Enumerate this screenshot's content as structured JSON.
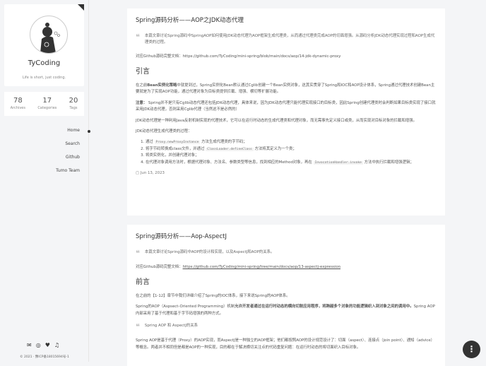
{
  "profile": {
    "name": "TyCoding",
    "motto": "Life is short, just coding."
  },
  "stats": [
    {
      "n": "78",
      "l": "Archives"
    },
    {
      "n": "17",
      "l": "Categories"
    },
    {
      "n": "20",
      "l": "Tags"
    }
  ],
  "nav": [
    "Home",
    "Search",
    "Github",
    "Tumo Team"
  ],
  "footer": {
    "copyright": "© 2021 · 豫ICP备18015694号-1"
  },
  "posts": [
    {
      "title": "Spring源码分析——AOP之JDK动态代理",
      "quote": "本篇文章讨论Spring源码中SpringAOP如何使用JDK动态代理为AOP框架生成代理类，从而通过代理类完成AOP的切面增强。从源码分析JDK动态代理实现过程和AOP生成代理类的过程。",
      "doc_label": "对应Github源码完整文档：",
      "doc_link": "https://github.com/TyCoding/mini-spring/blob/main/docs/aop/14-jdk-dynamic-proxy",
      "heading": "引言",
      "p1_a": "在之前",
      "p1_b": "Bean实例化策略",
      "p1_c": "中就提到过，Spring实例化Bean默认通过Cglib创建一个Bean实例对象，这其实贯穿了Spring和IOC和AOP设计体系，Spring通过代理技术创建Bean主要就是为了实现AOP功能，通过代理对象为目标类提供拦截、增强、横切等扩展功能。",
      "p2_a": "注意：",
      "p2_b": "Spring并不是只有Cglib动态代理还包括JDK动态代理，具体来说，因为JDK动态代理只能代理实现接口的目标类，因此Spring创建代理类时会判断如果目标类实现了接口就采用JDK动态代理，否则采用Cglib代理（当然这不是必然的）",
      "p3": "JDK动态代理是一种利用Java反射机制实现的代理技术，它可以在运行时动态的生成代理类和代理对象，而无需事先定义接口或类，从而实现对目标对象的拦截和增强。",
      "p4": "JDK动态代理生成代理类的过程：",
      "steps": [
        {
          "a": "通过 ",
          "code": "Proxy.newProxyInstance",
          "b": " 方法生成代理类的字节码；"
        },
        {
          "a": "将字节码转换成class文件，并通过 ",
          "code": "ClassLoader.defineClass",
          "b": " 方法将其定义为一个类；"
        },
        {
          "a": "将类实例化，并创建代理对象；",
          "code": "",
          "b": ""
        },
        {
          "a": "在代理对象调用方法时，根据代理对象、方法名、参数类型等信息，找到相应的Method对象，再在 ",
          "code": "InvocationHandler.invoke",
          "b": " 方法中执行拦截和增强逻辑；"
        }
      ],
      "date": "Jun 13, 2023"
    },
    {
      "title": "Spring源码分析——Aop-AspectJ",
      "quote": "本篇文章讨论Spring源码中AOP的设计和实现，以及AspectJ和AOP的关系。",
      "doc_label": "对应Github源码完整文档：",
      "doc_link": "https://github.com/TyCoding/mini-spring/tree/main/docs/aop/13-aspectj-expression",
      "heading": "前言",
      "p1": "在之前的【1-12】章节中我们详细介绍了Spring的IOC体系，接下来说Spring的AOP体系。",
      "p2_a": "Spring的AOP（Aspsect-Oriented Programming）机制",
      "p2_b": "允许开发者通过在运行时动态的横向切割应用程序，将跨越多个对象的功能逻辑织入到对象之间的调用中。",
      "p2_c": "Spring AOP内部采用了基于代理和基于字节码增强的两种方式。",
      "quote2": "Spring AOP 和 AspectJ的关系",
      "p3": "Spring AOP是基于代理（Proxy）的AOP实现，而AspectJ是一种独立的AOP框架；他们都按照AOP的设计规范设计了：切面（aspect）、连接点（join point）、通知（advice）等概念。两者并不相同但是都是AOP的一种实现，目的都在于解决横切关注点的代码重复问题：在运行时动态的将切面织入目标对象。"
    }
  ]
}
